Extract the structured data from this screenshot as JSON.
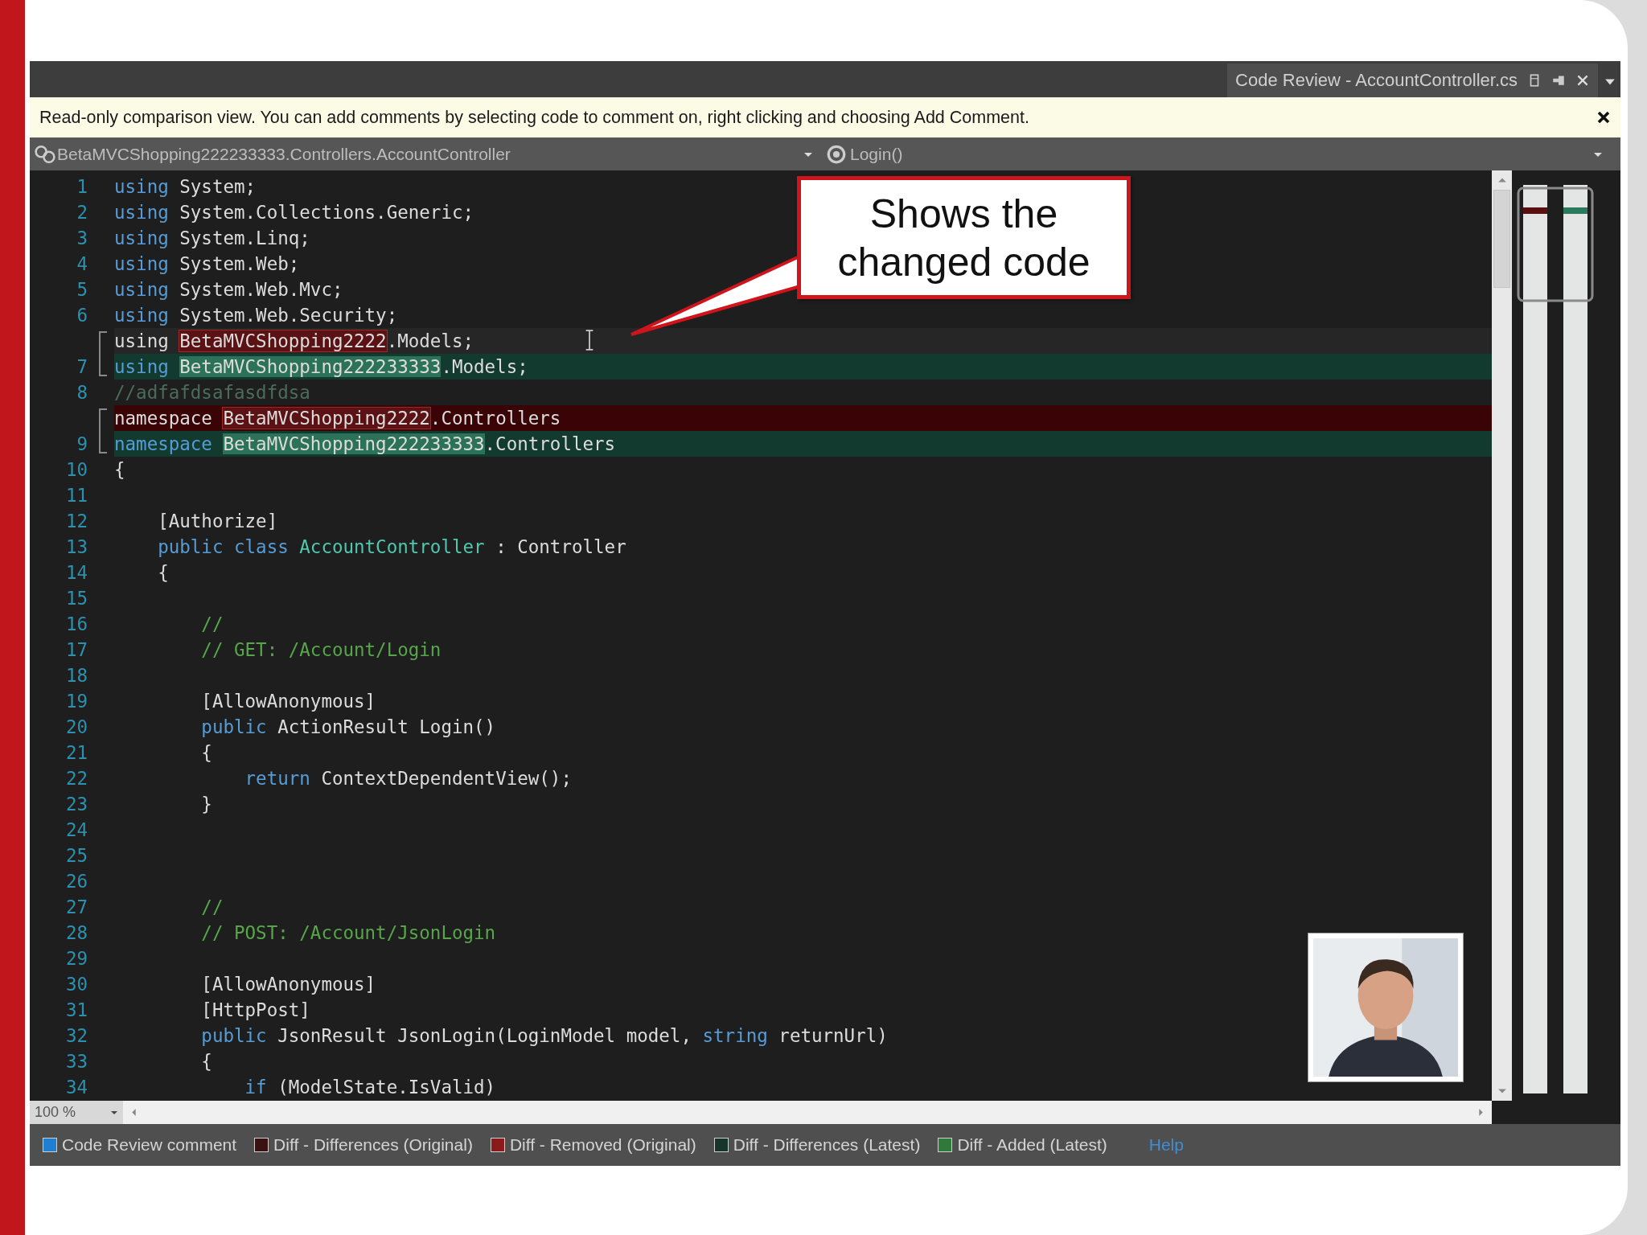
{
  "tab": {
    "title": "Code Review - AccountController.cs"
  },
  "info_bar": {
    "text": "Read-only comparison view. You can add comments by selecting code to comment on, right clicking and choosing Add Comment."
  },
  "navigation": {
    "type": "BetaMVCShopping222233333.Controllers.AccountController",
    "member": "Login()"
  },
  "code_lines": [
    {
      "number": "1",
      "kind": "unchanged",
      "segments": [
        {
          "kind": "keyword",
          "text": "using"
        },
        {
          "kind": "plain",
          "text": " System;"
        }
      ]
    },
    {
      "number": "2",
      "kind": "unchanged",
      "segments": [
        {
          "kind": "keyword",
          "text": "using"
        },
        {
          "kind": "plain",
          "text": " System.Collections.Generic;"
        }
      ]
    },
    {
      "number": "3",
      "kind": "unchanged",
      "segments": [
        {
          "kind": "keyword",
          "text": "using"
        },
        {
          "kind": "plain",
          "text": " System.Linq;"
        }
      ]
    },
    {
      "number": "4",
      "kind": "unchanged",
      "segments": [
        {
          "kind": "keyword",
          "text": "using"
        },
        {
          "kind": "plain",
          "text": " System.Web;"
        }
      ]
    },
    {
      "number": "5",
      "kind": "unchanged",
      "segments": [
        {
          "kind": "keyword",
          "text": "using"
        },
        {
          "kind": "plain",
          "text": " System.Web.Mvc;"
        }
      ]
    },
    {
      "number": "6",
      "kind": "unchanged",
      "segments": [
        {
          "kind": "keyword",
          "text": "using"
        },
        {
          "kind": "plain",
          "text": " System.Web.Security;"
        }
      ]
    },
    {
      "kind": "changed",
      "segments": [
        {
          "kind": "plain",
          "text": "using "
        },
        {
          "kind": "removed-word",
          "text": "BetaMVCShopping2222"
        },
        {
          "kind": "plain",
          "text": ".Models;"
        }
      ]
    },
    {
      "number": "7",
      "kind": "added",
      "segments": [
        {
          "kind": "keyword",
          "text": "using "
        },
        {
          "kind": "added-word",
          "text": "BetaMVCShopping222233333"
        },
        {
          "kind": "plain",
          "text": ".Models;"
        }
      ]
    },
    {
      "number": "8",
      "kind": "unchanged",
      "segments": [
        {
          "kind": "dim-comment",
          "text": "//adfafdsafasdfdsa"
        }
      ]
    },
    {
      "kind": "removed",
      "segments": [
        {
          "kind": "plain",
          "text": "namespace "
        },
        {
          "kind": "removed-word",
          "text": "BetaMVCShopping2222"
        },
        {
          "kind": "plain",
          "text": ".Controllers"
        }
      ]
    },
    {
      "number": "9",
      "kind": "added",
      "segments": [
        {
          "kind": "keyword",
          "text": "namespace "
        },
        {
          "kind": "added-word",
          "text": "BetaMVCShopping222233333"
        },
        {
          "kind": "plain",
          "text": ".Controllers"
        }
      ]
    },
    {
      "number": "10",
      "kind": "unchanged",
      "segments": [
        {
          "kind": "plain",
          "text": "{"
        }
      ]
    },
    {
      "number": "11",
      "kind": "unchanged"
    },
    {
      "number": "12",
      "kind": "unchanged",
      "segments": [
        {
          "kind": "plain",
          "text": "    [Authorize]"
        }
      ]
    },
    {
      "number": "13",
      "kind": "unchanged",
      "segments": [
        {
          "kind": "keyword",
          "text": "    public class"
        },
        {
          "kind": "type",
          "text": " AccountController"
        },
        {
          "kind": "plain",
          "text": " : Controller"
        }
      ]
    },
    {
      "number": "14",
      "kind": "unchanged",
      "segments": [
        {
          "kind": "plain",
          "text": "    {"
        }
      ]
    },
    {
      "number": "15",
      "kind": "unchanged"
    },
    {
      "number": "16",
      "kind": "unchanged",
      "segments": [
        {
          "kind": "comment",
          "text": "        //"
        }
      ]
    },
    {
      "number": "17",
      "kind": "unchanged",
      "segments": [
        {
          "kind": "comment",
          "text": "        // GET: /Account/Login"
        }
      ]
    },
    {
      "number": "18",
      "kind": "unchanged"
    },
    {
      "number": "19",
      "kind": "unchanged",
      "segments": [
        {
          "kind": "plain",
          "text": "        [AllowAnonymous]"
        }
      ]
    },
    {
      "number": "20",
      "kind": "unchanged",
      "segments": [
        {
          "kind": "keyword",
          "text": "        public"
        },
        {
          "kind": "plain",
          "text": " ActionResult Login()"
        }
      ]
    },
    {
      "number": "21",
      "kind": "unchanged",
      "segments": [
        {
          "kind": "plain",
          "text": "        {"
        }
      ]
    },
    {
      "number": "22",
      "kind": "unchanged",
      "segments": [
        {
          "kind": "keyword",
          "text": "            return"
        },
        {
          "kind": "plain",
          "text": " ContextDependentView();"
        }
      ]
    },
    {
      "number": "23",
      "kind": "unchanged",
      "segments": [
        {
          "kind": "plain",
          "text": "        }"
        }
      ]
    },
    {
      "number": "24",
      "kind": "unchanged"
    },
    {
      "number": "25",
      "kind": "unchanged"
    },
    {
      "number": "26",
      "kind": "unchanged"
    },
    {
      "number": "27",
      "kind": "unchanged",
      "segments": [
        {
          "kind": "comment",
          "text": "        //"
        }
      ]
    },
    {
      "number": "28",
      "kind": "unchanged",
      "segments": [
        {
          "kind": "comment",
          "text": "        // POST: /Account/JsonLogin"
        }
      ]
    },
    {
      "number": "29",
      "kind": "unchanged"
    },
    {
      "number": "30",
      "kind": "unchanged",
      "segments": [
        {
          "kind": "plain",
          "text": "        [AllowAnonymous]"
        }
      ]
    },
    {
      "number": "31",
      "kind": "unchanged",
      "segments": [
        {
          "kind": "plain",
          "text": "        [HttpPost]"
        }
      ]
    },
    {
      "number": "32",
      "kind": "unchanged",
      "segments": [
        {
          "kind": "keyword",
          "text": "        public"
        },
        {
          "kind": "plain",
          "text": " JsonResult JsonLogin(LoginModel model, "
        },
        {
          "kind": "keyword",
          "text": "string"
        },
        {
          "kind": "plain",
          "text": " returnUrl)"
        }
      ]
    },
    {
      "number": "33",
      "kind": "unchanged",
      "segments": [
        {
          "kind": "plain",
          "text": "        {"
        }
      ]
    },
    {
      "number": "34",
      "kind": "unchanged",
      "segments": [
        {
          "kind": "keyword",
          "text": "            if"
        },
        {
          "kind": "plain",
          "text": " (ModelState.IsValid)"
        }
      ]
    }
  ],
  "callout": {
    "text": "Shows the changed code"
  },
  "zoom": {
    "value": "100 %"
  },
  "legend": [
    {
      "label": "Code Review comment",
      "color": "#1f7fd0"
    },
    {
      "label": "Diff - Differences (Original)",
      "color": "#3b1212"
    },
    {
      "label": "Diff - Removed (Original)",
      "color": "#8b1a1a"
    },
    {
      "label": "Diff - Differences (Latest)",
      "color": "#17352d"
    },
    {
      "label": "Diff - Added (Latest)",
      "color": "#2f7a3a"
    }
  ],
  "help_link": "Help"
}
